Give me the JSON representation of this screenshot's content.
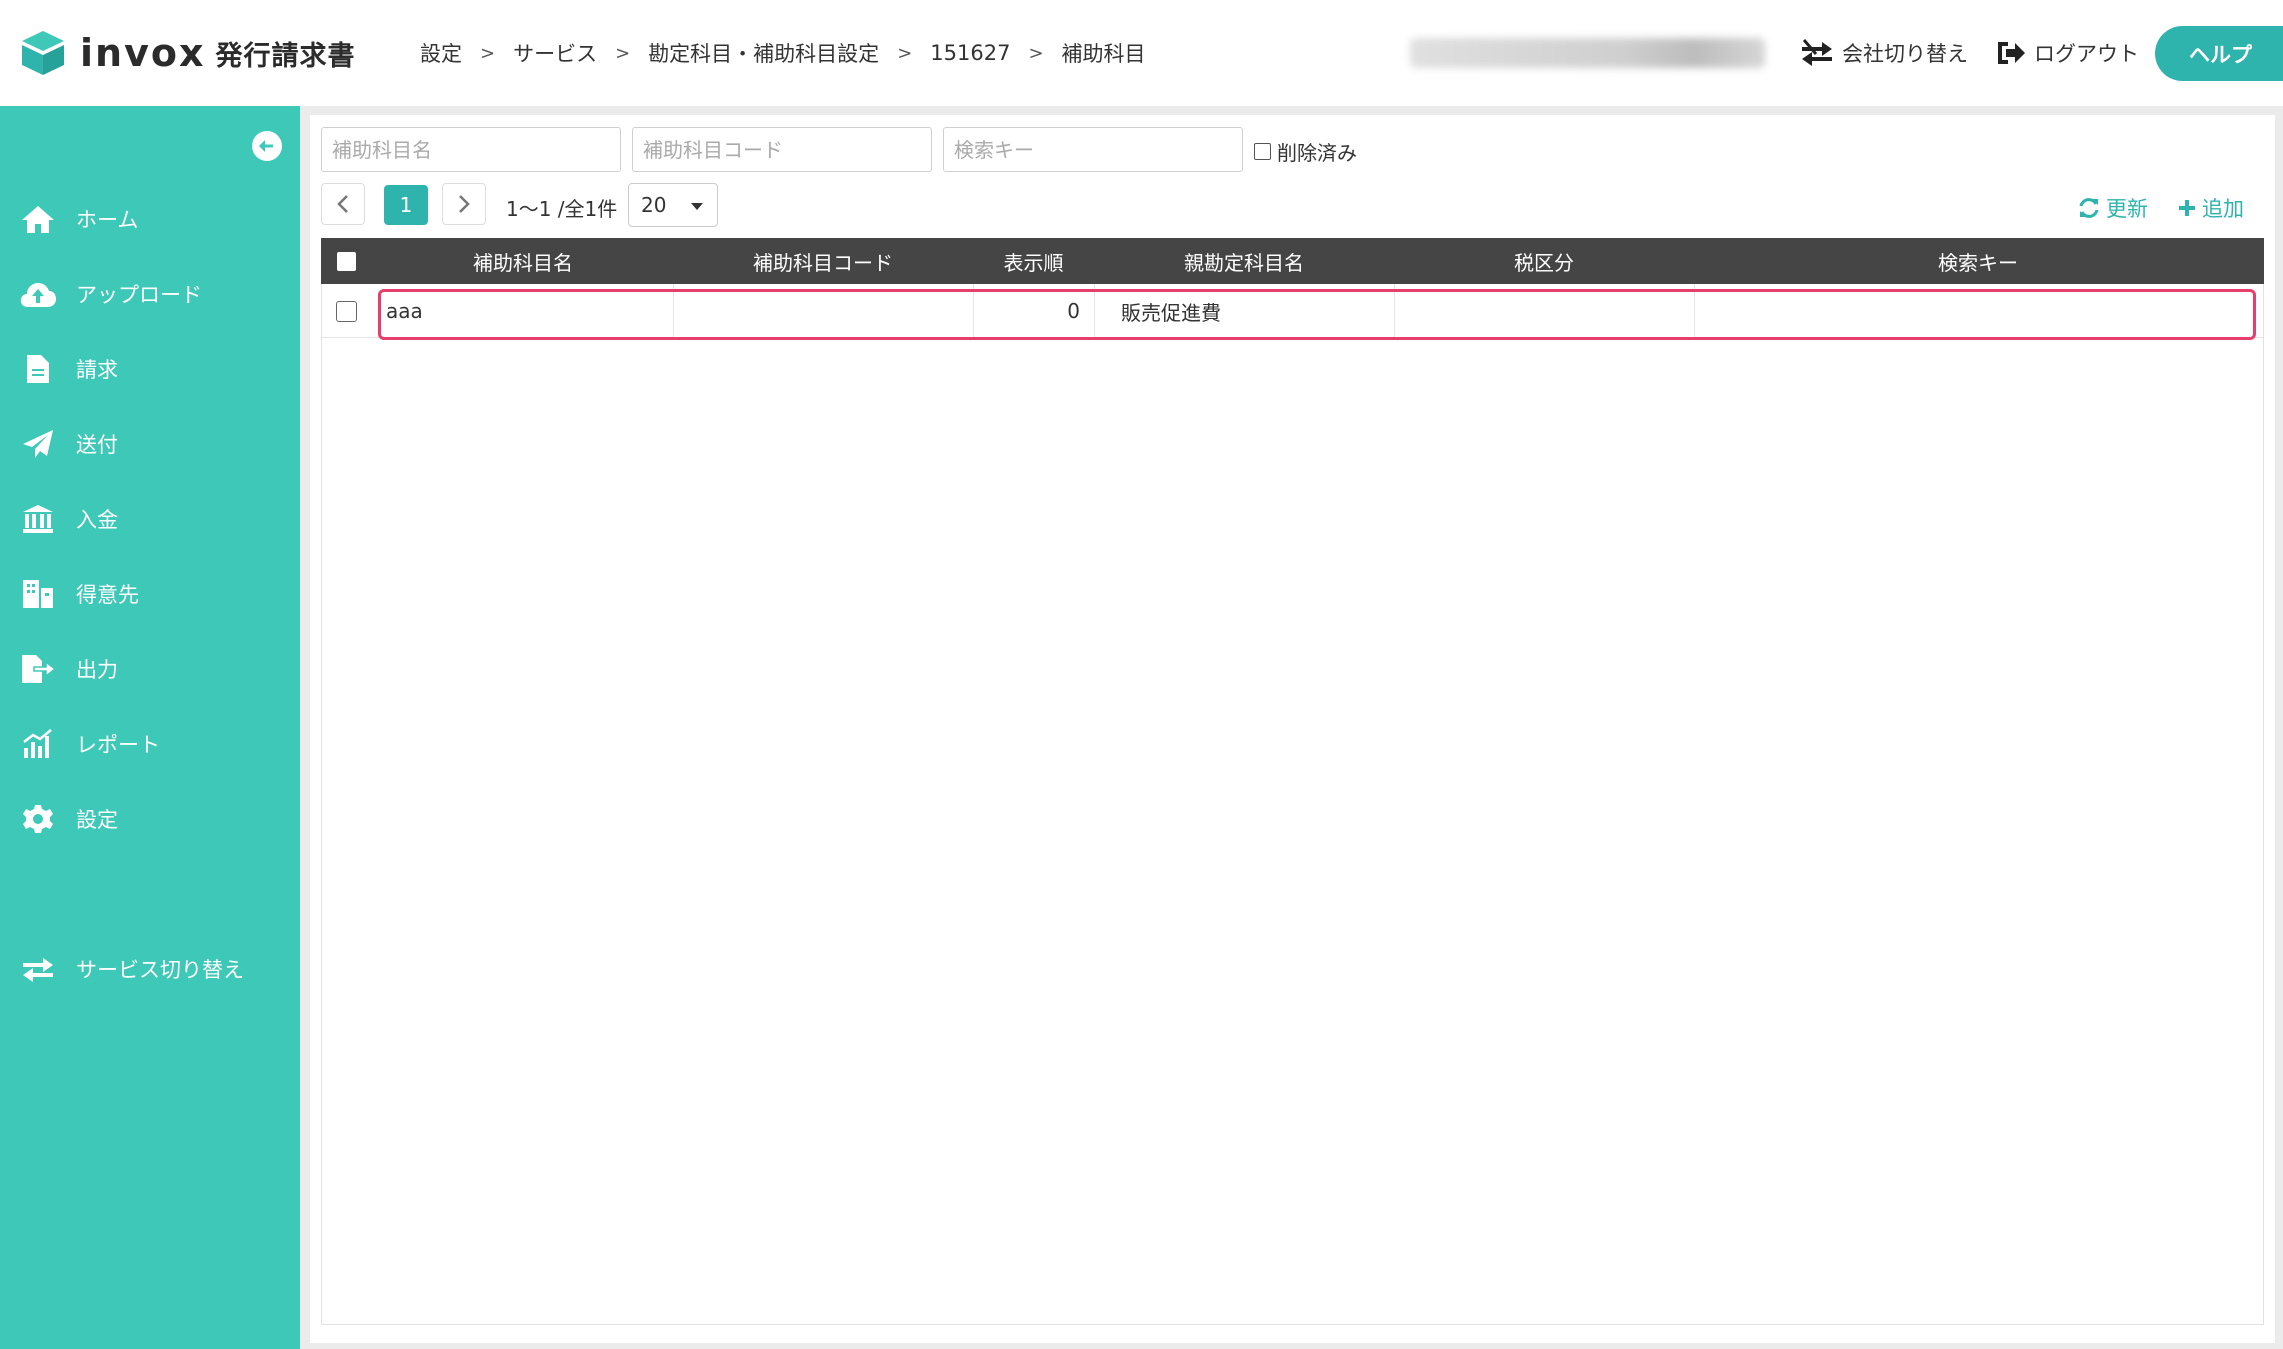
{
  "header": {
    "logo_text": "invox",
    "logo_sub": "発行請求書",
    "breadcrumb": [
      "設定",
      "サービス",
      "勘定科目・補助科目設定",
      "151627",
      "補助科目"
    ],
    "switch_company": "会社切り替え",
    "logout": "ログアウト",
    "help": "ヘルプ"
  },
  "sidebar": {
    "items": [
      {
        "label": "ホーム",
        "icon": "home-icon"
      },
      {
        "label": "アップロード",
        "icon": "cloud-upload-icon"
      },
      {
        "label": "請求",
        "icon": "document-icon"
      },
      {
        "label": "送付",
        "icon": "paper-plane-icon"
      },
      {
        "label": "入金",
        "icon": "bank-icon"
      },
      {
        "label": "得意先",
        "icon": "building-icon"
      },
      {
        "label": "出力",
        "icon": "file-export-icon"
      },
      {
        "label": "レポート",
        "icon": "bar-chart-icon"
      },
      {
        "label": "設定",
        "icon": "gear-icon"
      }
    ],
    "service_switch": "サービス切り替え"
  },
  "filters": {
    "name_placeholder": "補助科目名",
    "code_placeholder": "補助科目コード",
    "key_placeholder": "検索キー",
    "deleted_label": "削除済み"
  },
  "pager": {
    "current_page": "1",
    "range": "1〜1 /全1件",
    "per_page": "20"
  },
  "toolbar": {
    "refresh": "更新",
    "add": "追加"
  },
  "table": {
    "columns": [
      "補助科目名",
      "補助科目コード",
      "表示順",
      "親勘定科目名",
      "税区分",
      "検索キー"
    ],
    "rows": [
      {
        "name": "aaa",
        "code": "",
        "order": "0",
        "parent": "販売促進費",
        "tax": "",
        "key": ""
      }
    ]
  },
  "colors": {
    "accent": "#3ec8b8",
    "button": "#2fb4ad",
    "header_bg": "#454545",
    "highlight": "#e83e6c"
  }
}
